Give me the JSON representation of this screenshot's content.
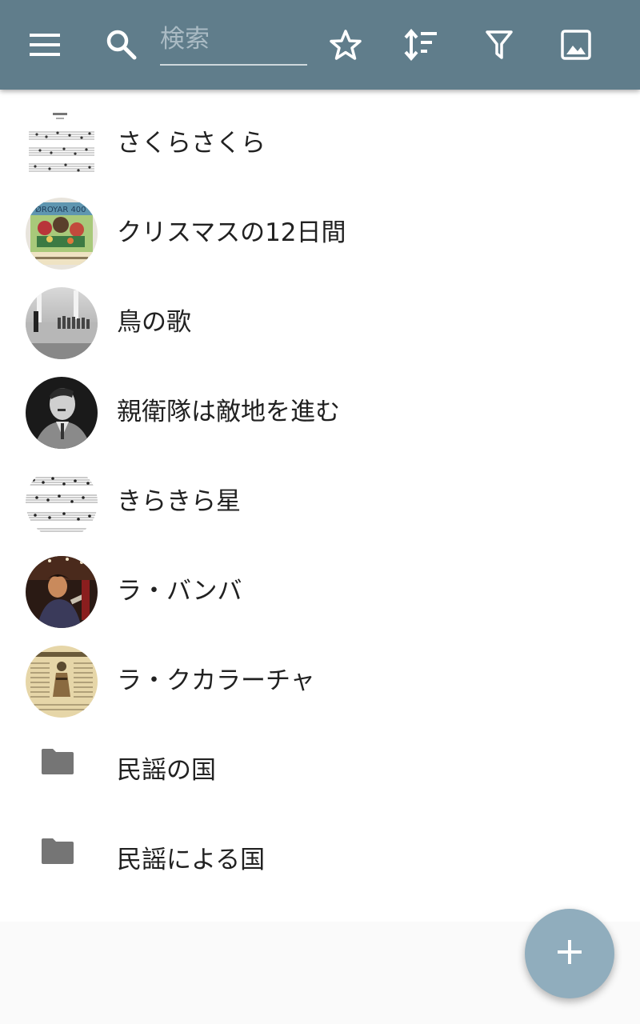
{
  "toolbar": {
    "background": "#607d8b",
    "menu_icon": "menu-icon",
    "search_icon": "search-icon",
    "search_placeholder": "検索",
    "search_value": "",
    "favorites_icon": "star-outline-icon",
    "sort_icon": "sort-icon",
    "filter_icon": "filter-icon",
    "image_icon": "image-icon"
  },
  "list": {
    "items": [
      {
        "label": "さくらさくら",
        "kind": "song",
        "thumbnail": "sheet-music-thumbnail"
      },
      {
        "label": "クリスマスの12日間",
        "kind": "song",
        "thumbnail": "stamp-thumbnail"
      },
      {
        "label": "鳥の歌",
        "kind": "song",
        "thumbnail": "bw-photo-thumbnail"
      },
      {
        "label": "親衛隊は敵地を進む",
        "kind": "song",
        "thumbnail": "portrait-thumbnail"
      },
      {
        "label": "きらきら星",
        "kind": "song",
        "thumbnail": "sheet-music-thumbnail"
      },
      {
        "label": "ラ・バンバ",
        "kind": "song",
        "thumbnail": "concert-photo-thumbnail"
      },
      {
        "label": "ラ・クカラーチャ",
        "kind": "song",
        "thumbnail": "old-print-thumbnail"
      },
      {
        "label": "民謡の国",
        "kind": "folder",
        "thumbnail": "folder-icon"
      },
      {
        "label": "民謡による国",
        "kind": "folder",
        "thumbnail": "folder-icon"
      }
    ]
  },
  "fab": {
    "icon": "plus-icon",
    "color": "#90adbd"
  }
}
